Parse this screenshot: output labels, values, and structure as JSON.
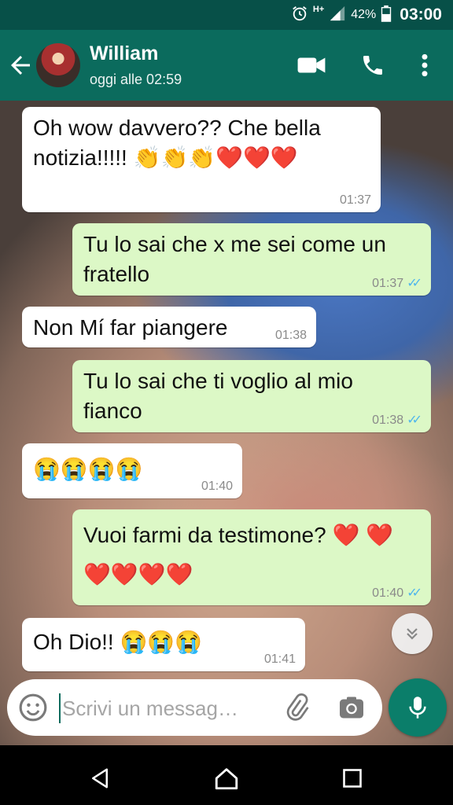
{
  "status_bar": {
    "network_type": "H+",
    "battery_percent": "42%",
    "time": "03:00",
    "icons": [
      "alarm-icon",
      "signal-icon",
      "battery-icon"
    ]
  },
  "header": {
    "contact_name": "William",
    "last_seen": "oggi alle 02:59",
    "icons": [
      "back-arrow-icon",
      "video-call-icon",
      "phone-call-icon",
      "more-vert-icon"
    ]
  },
  "messages": [
    {
      "direction": "in",
      "text": "Oh wow davvero??  Che bella notizia!!!!! 👏👏👏❤️❤️❤️",
      "time": "01:37"
    },
    {
      "direction": "out",
      "text": "Tu lo sai che x me sei come un fratello",
      "time": "01:37",
      "read": true
    },
    {
      "direction": "in",
      "text": "Non Mí far piangere",
      "time": "01:38"
    },
    {
      "direction": "out",
      "text": "Tu lo sai che ti voglio al mio fianco",
      "time": "01:38",
      "read": true
    },
    {
      "direction": "in",
      "text": "😭😭😭😭",
      "time": "01:40"
    },
    {
      "direction": "out",
      "text": "Vuoi farmi da testimone? ❤️ ❤️❤️❤️❤️❤️",
      "time": "01:40",
      "read": true
    },
    {
      "direction": "in",
      "text": "Oh Dio!!  😭😭😭",
      "time": "01:41"
    }
  ],
  "composer": {
    "placeholder": "Scrivi un messag…",
    "value": ""
  },
  "colors": {
    "header": "#0b6b5d",
    "status_bar": "#075048",
    "outgoing_bubble": "#dcf8c6",
    "incoming_bubble": "#ffffff",
    "read_ticks": "#4fb6ec",
    "mic_button": "#0b7e6a"
  }
}
